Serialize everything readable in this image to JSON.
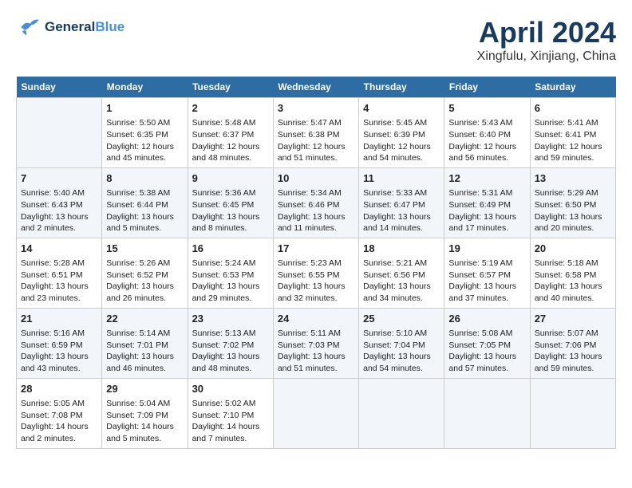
{
  "header": {
    "logo_line1": "General",
    "logo_line2": "Blue",
    "month": "April 2024",
    "location": "Xingfulu, Xinjiang, China"
  },
  "weekdays": [
    "Sunday",
    "Monday",
    "Tuesday",
    "Wednesday",
    "Thursday",
    "Friday",
    "Saturday"
  ],
  "weeks": [
    [
      {
        "day": "",
        "info": ""
      },
      {
        "day": "1",
        "info": "Sunrise: 5:50 AM\nSunset: 6:35 PM\nDaylight: 12 hours\nand 45 minutes."
      },
      {
        "day": "2",
        "info": "Sunrise: 5:48 AM\nSunset: 6:37 PM\nDaylight: 12 hours\nand 48 minutes."
      },
      {
        "day": "3",
        "info": "Sunrise: 5:47 AM\nSunset: 6:38 PM\nDaylight: 12 hours\nand 51 minutes."
      },
      {
        "day": "4",
        "info": "Sunrise: 5:45 AM\nSunset: 6:39 PM\nDaylight: 12 hours\nand 54 minutes."
      },
      {
        "day": "5",
        "info": "Sunrise: 5:43 AM\nSunset: 6:40 PM\nDaylight: 12 hours\nand 56 minutes."
      },
      {
        "day": "6",
        "info": "Sunrise: 5:41 AM\nSunset: 6:41 PM\nDaylight: 12 hours\nand 59 minutes."
      }
    ],
    [
      {
        "day": "7",
        "info": "Sunrise: 5:40 AM\nSunset: 6:43 PM\nDaylight: 13 hours\nand 2 minutes."
      },
      {
        "day": "8",
        "info": "Sunrise: 5:38 AM\nSunset: 6:44 PM\nDaylight: 13 hours\nand 5 minutes."
      },
      {
        "day": "9",
        "info": "Sunrise: 5:36 AM\nSunset: 6:45 PM\nDaylight: 13 hours\nand 8 minutes."
      },
      {
        "day": "10",
        "info": "Sunrise: 5:34 AM\nSunset: 6:46 PM\nDaylight: 13 hours\nand 11 minutes."
      },
      {
        "day": "11",
        "info": "Sunrise: 5:33 AM\nSunset: 6:47 PM\nDaylight: 13 hours\nand 14 minutes."
      },
      {
        "day": "12",
        "info": "Sunrise: 5:31 AM\nSunset: 6:49 PM\nDaylight: 13 hours\nand 17 minutes."
      },
      {
        "day": "13",
        "info": "Sunrise: 5:29 AM\nSunset: 6:50 PM\nDaylight: 13 hours\nand 20 minutes."
      }
    ],
    [
      {
        "day": "14",
        "info": "Sunrise: 5:28 AM\nSunset: 6:51 PM\nDaylight: 13 hours\nand 23 minutes."
      },
      {
        "day": "15",
        "info": "Sunrise: 5:26 AM\nSunset: 6:52 PM\nDaylight: 13 hours\nand 26 minutes."
      },
      {
        "day": "16",
        "info": "Sunrise: 5:24 AM\nSunset: 6:53 PM\nDaylight: 13 hours\nand 29 minutes."
      },
      {
        "day": "17",
        "info": "Sunrise: 5:23 AM\nSunset: 6:55 PM\nDaylight: 13 hours\nand 32 minutes."
      },
      {
        "day": "18",
        "info": "Sunrise: 5:21 AM\nSunset: 6:56 PM\nDaylight: 13 hours\nand 34 minutes."
      },
      {
        "day": "19",
        "info": "Sunrise: 5:19 AM\nSunset: 6:57 PM\nDaylight: 13 hours\nand 37 minutes."
      },
      {
        "day": "20",
        "info": "Sunrise: 5:18 AM\nSunset: 6:58 PM\nDaylight: 13 hours\nand 40 minutes."
      }
    ],
    [
      {
        "day": "21",
        "info": "Sunrise: 5:16 AM\nSunset: 6:59 PM\nDaylight: 13 hours\nand 43 minutes."
      },
      {
        "day": "22",
        "info": "Sunrise: 5:14 AM\nSunset: 7:01 PM\nDaylight: 13 hours\nand 46 minutes."
      },
      {
        "day": "23",
        "info": "Sunrise: 5:13 AM\nSunset: 7:02 PM\nDaylight: 13 hours\nand 48 minutes."
      },
      {
        "day": "24",
        "info": "Sunrise: 5:11 AM\nSunset: 7:03 PM\nDaylight: 13 hours\nand 51 minutes."
      },
      {
        "day": "25",
        "info": "Sunrise: 5:10 AM\nSunset: 7:04 PM\nDaylight: 13 hours\nand 54 minutes."
      },
      {
        "day": "26",
        "info": "Sunrise: 5:08 AM\nSunset: 7:05 PM\nDaylight: 13 hours\nand 57 minutes."
      },
      {
        "day": "27",
        "info": "Sunrise: 5:07 AM\nSunset: 7:06 PM\nDaylight: 13 hours\nand 59 minutes."
      }
    ],
    [
      {
        "day": "28",
        "info": "Sunrise: 5:05 AM\nSunset: 7:08 PM\nDaylight: 14 hours\nand 2 minutes."
      },
      {
        "day": "29",
        "info": "Sunrise: 5:04 AM\nSunset: 7:09 PM\nDaylight: 14 hours\nand 5 minutes."
      },
      {
        "day": "30",
        "info": "Sunrise: 5:02 AM\nSunset: 7:10 PM\nDaylight: 14 hours\nand 7 minutes."
      },
      {
        "day": "",
        "info": ""
      },
      {
        "day": "",
        "info": ""
      },
      {
        "day": "",
        "info": ""
      },
      {
        "day": "",
        "info": ""
      }
    ]
  ]
}
